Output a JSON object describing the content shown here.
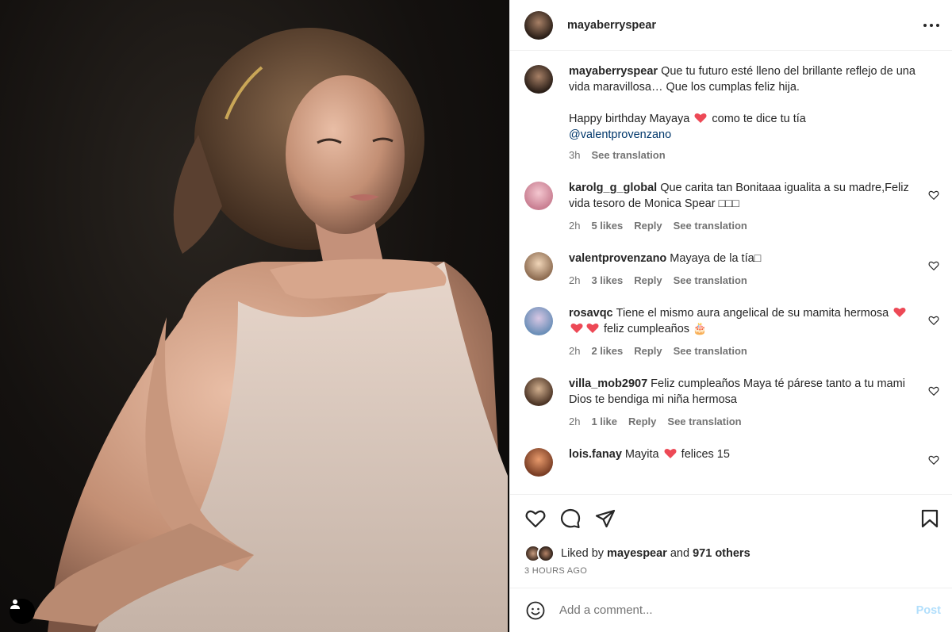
{
  "post": {
    "author": "mayaberryspear",
    "caption_text": "Que tu futuro esté lleno del brillante reflejo de una vida maravillosa… Que los cumplas feliz hija.",
    "caption_line2a": "Happy birthday Mayaya",
    "caption_line2b": "como te dice tu tía",
    "caption_mention": "@valentprovenzano",
    "caption_time": "3h",
    "see_translation": "See translation"
  },
  "comments": [
    {
      "user": "karolg_g_global",
      "text": "Que carita tan Bonitaaa igualita a su madre,Feliz vida tesoro de Monica Spear □□□",
      "time": "2h",
      "likes": "5 likes",
      "reply": "Reply",
      "translate": "See translation",
      "avatar_color": "#e7a7b4"
    },
    {
      "user": "valentprovenzano",
      "text": "Mayaya de la tía□",
      "time": "2h",
      "likes": "3 likes",
      "reply": "Reply",
      "translate": "See translation",
      "avatar_color": "#c9b08f"
    },
    {
      "user": "rosavqc",
      "text_a": "Tiene el mismo aura angelical de su mamita hermosa",
      "text_b": "feliz cumpleaños",
      "cake": "🎂",
      "time": "2h",
      "likes": "2 likes",
      "reply": "Reply",
      "translate": "See translation",
      "avatar_color": "#a88fb5"
    },
    {
      "user": "villa_mob2907",
      "text": "Feliz cumpleaños Maya té párese tanto a tu mami Dios te bendiga mi niña hermosa",
      "time": "2h",
      "likes": "1 like",
      "reply": "Reply",
      "translate": "See translation",
      "avatar_color": "#8c6c50"
    },
    {
      "user": "lois.fanay",
      "text_a": "Mayita",
      "text_b": "felices 15",
      "avatar_color": "#c47a52"
    }
  ],
  "likes": {
    "prefix": "Liked by",
    "user": "mayespear",
    "and": "and",
    "others": "971 others",
    "ago": "3 HOURS AGO"
  },
  "composer": {
    "placeholder": "Add a comment...",
    "post_label": "Post"
  },
  "colors": {
    "heart_red": "#ed4956",
    "link_blue": "#00376b",
    "post_disabled": "#b2dffc"
  }
}
